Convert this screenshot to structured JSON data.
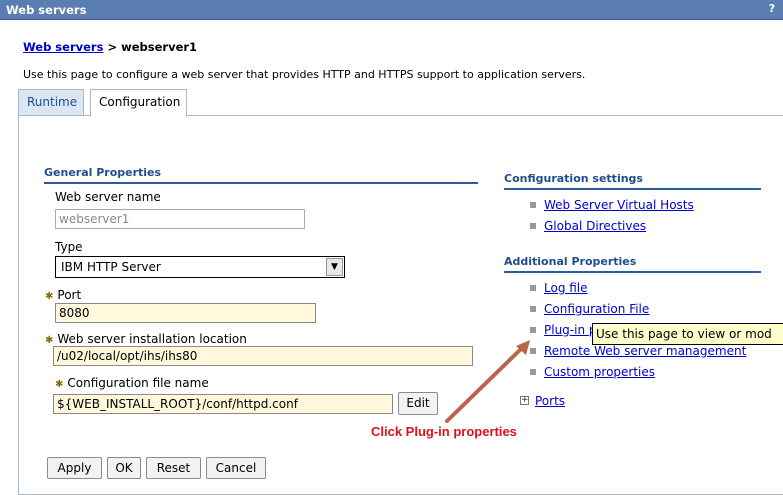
{
  "window": {
    "title": "Web servers",
    "help": "?"
  },
  "breadcrumb": {
    "parent": "Web servers",
    "separator": " > ",
    "current": "webserver1"
  },
  "description": "Use this page to configure a web server that provides HTTP and HTTPS support to application servers.",
  "tabs": [
    {
      "label": "Runtime"
    },
    {
      "label": "Configuration"
    }
  ],
  "general": {
    "heading": "General Properties",
    "name_label": "Web server name",
    "name_value": "webserver1",
    "type_label": "Type",
    "type_value": "IBM HTTP Server",
    "port_label": "Port",
    "port_value": "8080",
    "install_label": "Web server installation location",
    "install_value": "/u02/local/opt/ihs/ihs80",
    "conf_label": "Configuration file name",
    "conf_value": "${WEB_INSTALL_ROOT}/conf/httpd.conf",
    "edit_label": "Edit"
  },
  "config_settings": {
    "heading": "Configuration settings",
    "items": [
      "Web Server Virtual Hosts",
      "Global Directives"
    ]
  },
  "additional": {
    "heading": "Additional Properties",
    "items": [
      "Log file",
      "Configuration File",
      "Plug-in p",
      "Remote Web server management",
      "Custom properties"
    ],
    "ports": "Ports"
  },
  "tooltip": "Use this page to view or mod",
  "annotation": "Click Plug-in properties",
  "buttons": {
    "apply": "Apply",
    "ok": "OK",
    "reset": "Reset",
    "cancel": "Cancel"
  },
  "colors": {
    "titlebar": "#5a7eb0",
    "link": "#0000cc",
    "annotation": "#e0101a",
    "arrow": "#b8664a"
  }
}
